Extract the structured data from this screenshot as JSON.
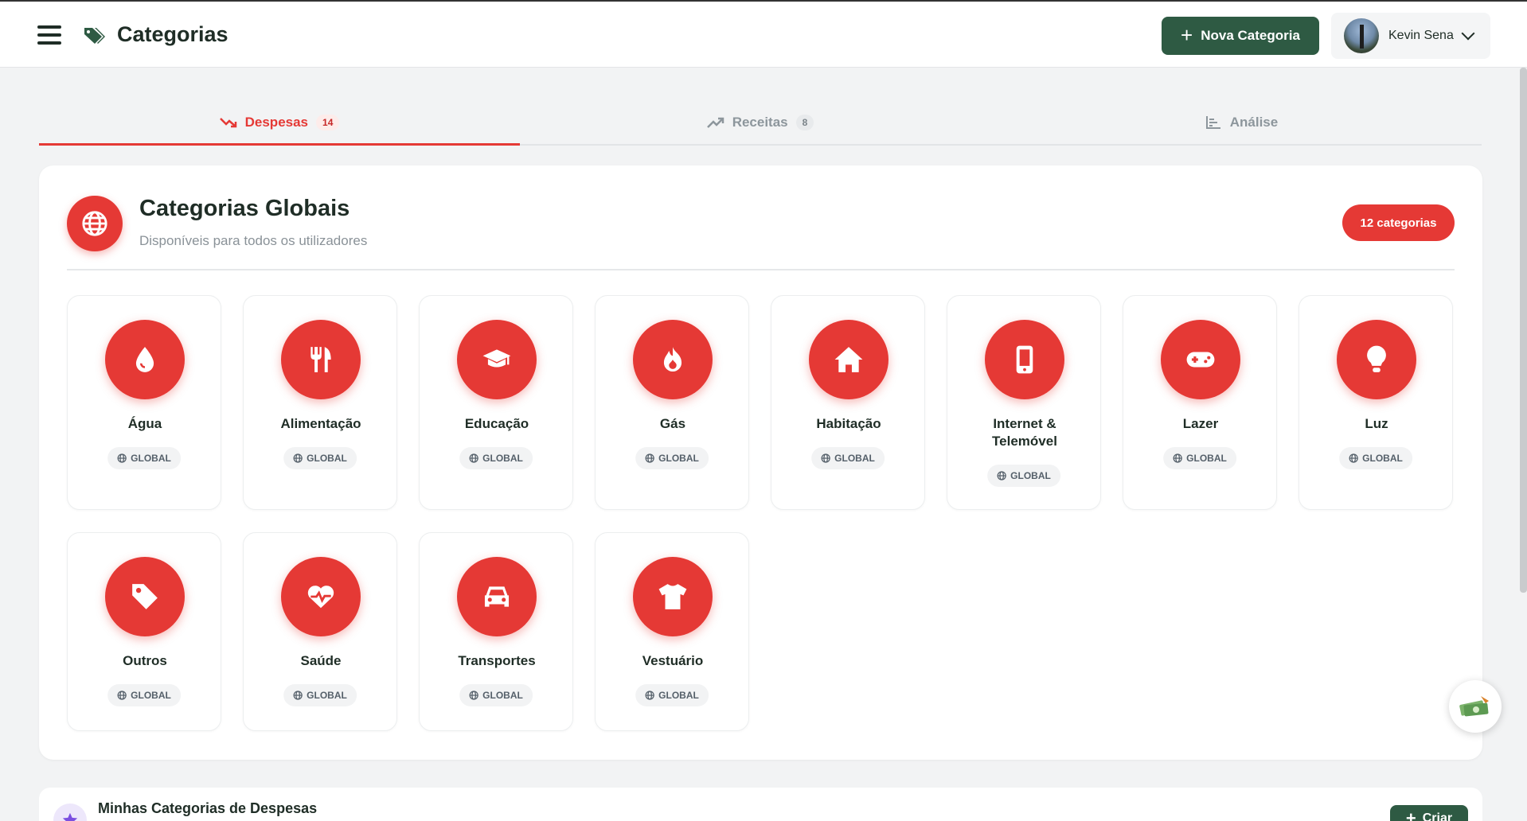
{
  "header": {
    "title": "Categorias",
    "new_button_label": "Nova Categoria",
    "user_name": "Kevin Sena"
  },
  "tabs": [
    {
      "label": "Despesas",
      "count": "14",
      "active": true
    },
    {
      "label": "Receitas",
      "count": "8",
      "active": false
    },
    {
      "label": "Análise",
      "count": "",
      "active": false
    }
  ],
  "global_section": {
    "title": "Categorias Globais",
    "subtitle": "Disponíveis para todos os utilizadores",
    "count_badge": "12 categorias",
    "badge_label": "GLOBAL",
    "categories": [
      {
        "name": "Água",
        "icon": "droplet-icon"
      },
      {
        "name": "Alimentação",
        "icon": "utensils-icon"
      },
      {
        "name": "Educação",
        "icon": "graduation-cap-icon"
      },
      {
        "name": "Gás",
        "icon": "fire-icon"
      },
      {
        "name": "Habitação",
        "icon": "house-icon"
      },
      {
        "name": "Internet & Telemóvel",
        "icon": "mobile-phone-icon"
      },
      {
        "name": "Lazer",
        "icon": "gamepad-icon"
      },
      {
        "name": "Luz",
        "icon": "lightbulb-icon"
      },
      {
        "name": "Outros",
        "icon": "tag-icon"
      },
      {
        "name": "Saúde",
        "icon": "heart-pulse-icon"
      },
      {
        "name": "Transportes",
        "icon": "car-icon"
      },
      {
        "name": "Vestuário",
        "icon": "shirt-icon"
      }
    ]
  },
  "my_section": {
    "title": "Minhas Categorias de Despesas",
    "create_label": "Criar"
  },
  "colors": {
    "accent_red": "#e53935",
    "brand_green": "#2e5a43",
    "background": "#f2f3f4"
  }
}
